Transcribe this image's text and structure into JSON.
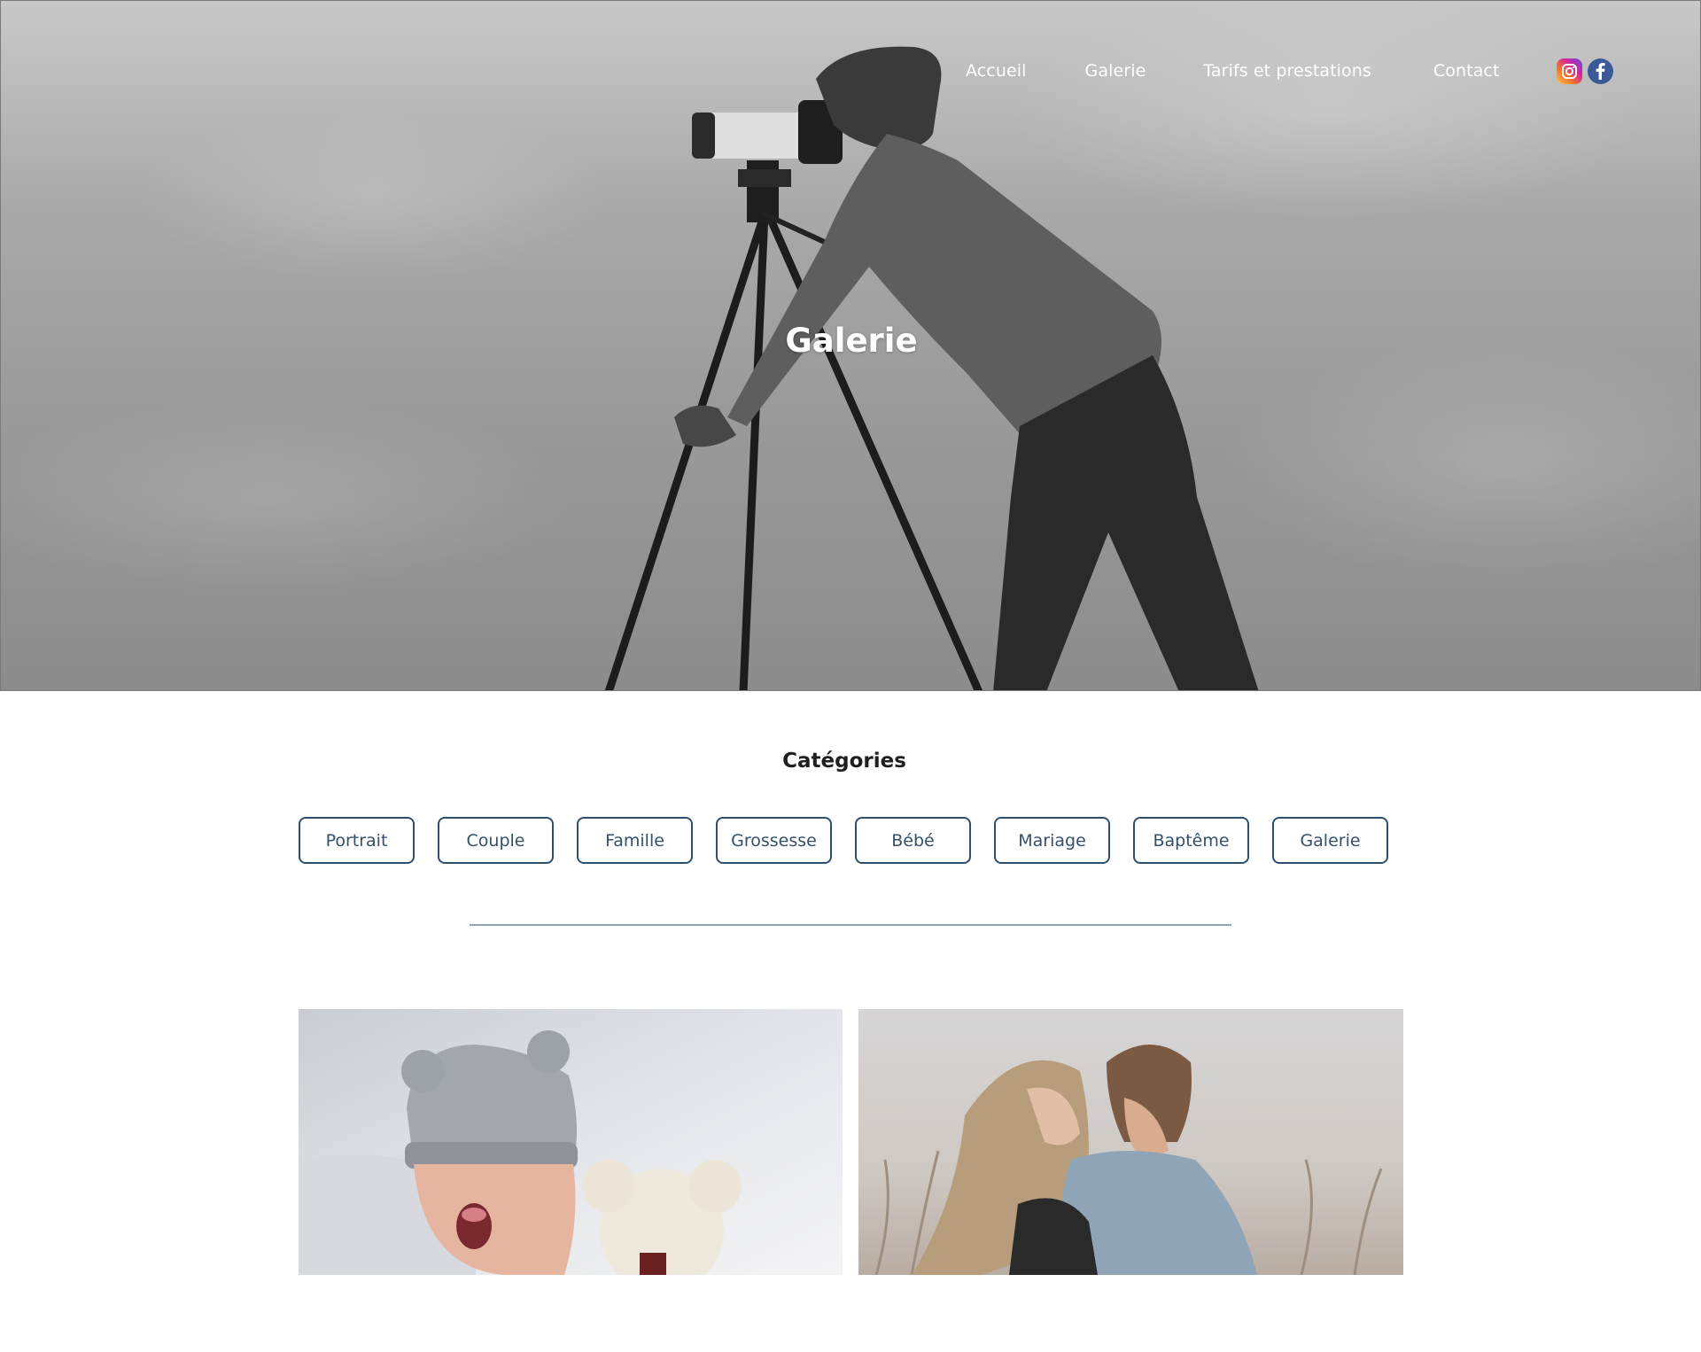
{
  "nav": {
    "items": [
      {
        "label": "Accueil"
      },
      {
        "label": "Galerie"
      },
      {
        "label": "Tarifs et prestations"
      },
      {
        "label": "Contact"
      }
    ],
    "social": [
      {
        "icon": "instagram-icon"
      },
      {
        "icon": "facebook-icon"
      }
    ]
  },
  "hero": {
    "title": "Galerie"
  },
  "categories": {
    "title": "Catégories",
    "buttons": [
      {
        "label": "Portrait"
      },
      {
        "label": "Couple"
      },
      {
        "label": "Famille"
      },
      {
        "label": "Grossesse"
      },
      {
        "label": "Bébé"
      },
      {
        "label": "Mariage"
      },
      {
        "label": "Baptême"
      },
      {
        "label": "Galerie"
      }
    ]
  },
  "colors": {
    "button_border": "#2e4e6e",
    "button_text": "#34506b",
    "divider": "#8aa4b8",
    "nav_text": "#ffffff"
  }
}
